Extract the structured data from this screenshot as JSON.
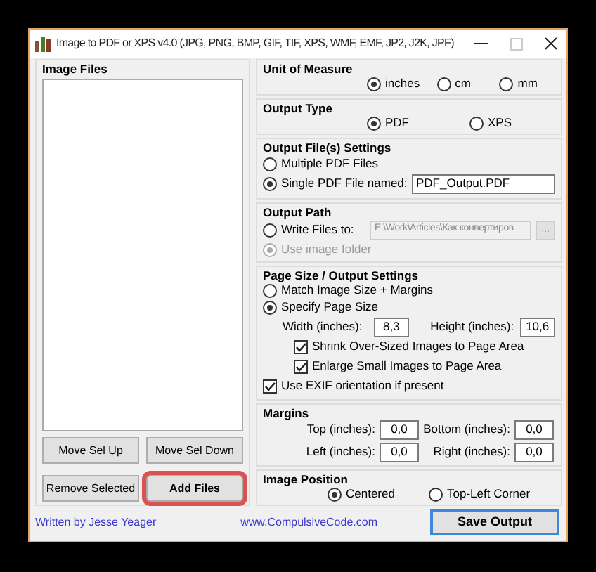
{
  "window": {
    "title": "Image to PDF or XPS  v4.0  (JPG, PNG, BMP, GIF, TIF, XPS, WMF, EMF, JP2, J2K, JPF)"
  },
  "image_files": {
    "title": "Image Files",
    "buttons": [
      {
        "label": "Move Sel Up",
        "highlighted": false
      },
      {
        "label": "Move Sel Down",
        "highlighted": false
      },
      {
        "label": "Remove Selected",
        "highlighted": false
      },
      {
        "label": "Add Files",
        "highlighted": true
      }
    ]
  },
  "unit_of_measure": {
    "title": "Unit of Measure",
    "options": [
      {
        "label": "inches",
        "selected": true
      },
      {
        "label": "cm",
        "selected": false
      },
      {
        "label": "mm",
        "selected": false
      }
    ]
  },
  "output_type": {
    "title": "Output Type",
    "options": [
      {
        "label": "PDF",
        "selected": true
      },
      {
        "label": "XPS",
        "selected": false
      }
    ]
  },
  "output_file_settings": {
    "title": "Output File(s) Settings",
    "options": [
      {
        "label": "Multiple PDF Files",
        "selected": false
      },
      {
        "label": "Single PDF File named:",
        "selected": true
      }
    ],
    "file_name": "PDF_Output.PDF"
  },
  "output_path": {
    "title": "Output Path",
    "options": [
      {
        "label": "Write Files to:",
        "selected": false,
        "disabled": false
      },
      {
        "label": "Use image folder",
        "selected": true,
        "disabled": true
      }
    ],
    "path": "E:\\Work\\Articles\\Как конвертиров",
    "path_disabled": true,
    "browse_button": "..."
  },
  "page_size": {
    "title": "Page Size / Output Settings",
    "options": [
      {
        "label": "Match Image Size + Margins",
        "selected": false
      },
      {
        "label": "Specify Page Size",
        "selected": true
      }
    ],
    "width_label": "Width (inches):",
    "width_value": "8,3",
    "height_label": "Height (inches):",
    "height_value": "10,6",
    "scale_options": [
      {
        "label": "Shrink Over-Sized Images to Page Area",
        "checked": true
      },
      {
        "label": "Enlarge Small Images to Page Area",
        "checked": true
      }
    ],
    "exif": {
      "label": "Use EXIF orientation if present",
      "checked": true
    }
  },
  "margins": {
    "title": "Margins",
    "fields": [
      {
        "label": "Top (inches):",
        "value": "0,0"
      },
      {
        "label": "Bottom (inches):",
        "value": "0,0"
      },
      {
        "label": "Left (inches):",
        "value": "0,0"
      },
      {
        "label": "Right (inches):",
        "value": "0,0"
      }
    ]
  },
  "image_position": {
    "title": "Image Position",
    "options": [
      {
        "label": "Centered",
        "selected": true
      },
      {
        "label": "Top-Left Corner",
        "selected": false
      }
    ]
  },
  "footer": {
    "author": "Written by Jesse Yeager",
    "website": "www.CompulsiveCode.com",
    "save_button": "Save Output"
  }
}
